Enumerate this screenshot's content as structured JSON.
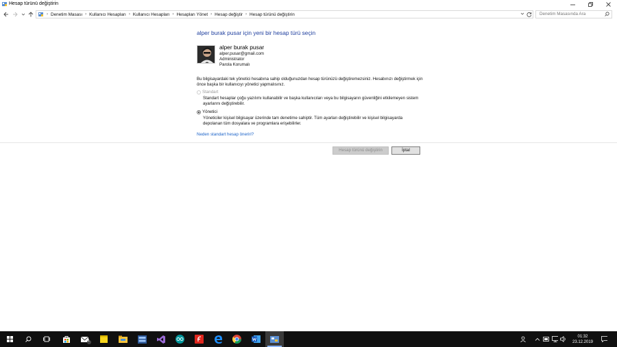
{
  "window": {
    "title": "Hesap türünü değiştirin"
  },
  "breadcrumb": [
    "Denetim Masası",
    "Kullanıcı Hesapları",
    "Kullanıcı Hesapları",
    "Hesapları Yönet",
    "Hesap değiştir",
    "Hesap türünü değiştirin"
  ],
  "search": {
    "placeholder": "Denetim Masasında Ara"
  },
  "page": {
    "heading": "alper burak pusar için yeni bir hesap türü seçin",
    "user": {
      "name": "alper burak pusar",
      "email": "alper.pusar@gmail.com",
      "role": "Administrator",
      "protection": "Parola Korumalı"
    },
    "notice": "Bu bilgisayardaki tek yönetici hesabına sahip olduğunuzdan hesap türünüzü değiştiremezsiniz. Hesabınızı değiştirmek için önce başka bir kullanıcıyı yönetici yapmalısınız.",
    "options": {
      "standard": {
        "label": "Standart",
        "description": "Standart hesaplar çoğu yazılımı kullanabilir ve başka kullanıcıları veya bu bilgisayarın güvenliğini etkilemeyen sistem ayarlarını değiştirebilir.",
        "selected": false,
        "disabled": true
      },
      "admin": {
        "label": "Yönetici",
        "description": "Yöneticiler kişisel bilgisayar üzerinde tam denetime sahiptir. Tüm ayarları değiştirebilir ve kişisel bilgisayarda depolanan tüm dosyalara ve programlara erişebilirler.",
        "selected": true,
        "disabled": false
      }
    },
    "link": "Neden standart hesap öneriri?",
    "buttons": {
      "change": "Hesap türünü değiştirin",
      "cancel": "İptal"
    }
  },
  "taskbar": {
    "apps": [
      "start-icon",
      "search-icon",
      "task-view-icon",
      "store-icon",
      "mail-icon",
      "sticky-notes-icon",
      "file-explorer-icon",
      "app-icon",
      "visual-studio-icon",
      "arduino-icon",
      "flash-icon",
      "edge-icon",
      "chrome-icon",
      "word-icon",
      "control-panel-icon"
    ],
    "mail_badge": "1",
    "clock": {
      "time": "01:32",
      "date": "23.12.2019"
    }
  },
  "colors": {
    "heading": "#1e3e9e",
    "link": "#1a62c8",
    "taskbar": "#101010"
  }
}
